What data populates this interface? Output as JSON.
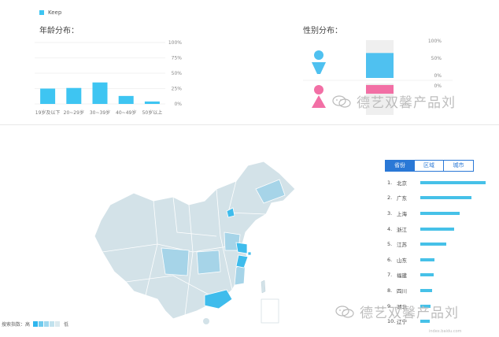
{
  "legend": {
    "series_name": "Keep",
    "color": "#3ec5f2"
  },
  "age": {
    "title": "年龄分布：",
    "chart_data": {
      "type": "bar",
      "categories": [
        "19岁及以下",
        "20~29岁",
        "30~39岁",
        "40~49岁",
        "50岁以上"
      ],
      "values": [
        25,
        26,
        35,
        13,
        4
      ],
      "ylim": [
        0,
        100
      ],
      "yticks": [
        "0%",
        "25%",
        "50%",
        "75%",
        "100%"
      ],
      "color": "#3ec5f2"
    }
  },
  "gender": {
    "title": "性别分布：",
    "male": {
      "value": 66,
      "ticks": [
        "100%",
        "50%",
        "0%"
      ],
      "icon": "male-icon",
      "color": "#4fc1f0"
    },
    "female": {
      "value": 34,
      "ticks": [
        "0%"
      ],
      "icon": "female-icon",
      "color": "#f26fa5"
    }
  },
  "ranking": {
    "tabs": [
      "省份",
      "区域",
      "城市"
    ],
    "active_tab": 0,
    "items": [
      {
        "rank": "1.",
        "name": "北京",
        "value": 100
      },
      {
        "rank": "2.",
        "name": "广东",
        "value": 78
      },
      {
        "rank": "3.",
        "name": "上海",
        "value": 60
      },
      {
        "rank": "4.",
        "name": "浙江",
        "value": 52
      },
      {
        "rank": "5.",
        "name": "江苏",
        "value": 40
      },
      {
        "rank": "6.",
        "name": "山东",
        "value": 22
      },
      {
        "rank": "7.",
        "name": "福建",
        "value": 20
      },
      {
        "rank": "8.",
        "name": "四川",
        "value": 18
      },
      {
        "rank": "9.",
        "name": "湖北",
        "value": 16
      },
      {
        "rank": "10.",
        "name": "辽宁",
        "value": 14
      }
    ]
  },
  "map_scale": {
    "label_left": "搜索指数：高",
    "label_right": "低",
    "colors": [
      "#2fb6ee",
      "#6fcbee",
      "#9fd8ef",
      "#c2e2ee",
      "#dbe9ee"
    ]
  },
  "map_colors": {
    "base": "#d3e2e8",
    "mid": "#a6d4e8",
    "high": "#3fbcec",
    "border": "#ffffff"
  },
  "watermark": {
    "text": "德艺双馨产品刘"
  },
  "source_note": "index.baidu.com"
}
